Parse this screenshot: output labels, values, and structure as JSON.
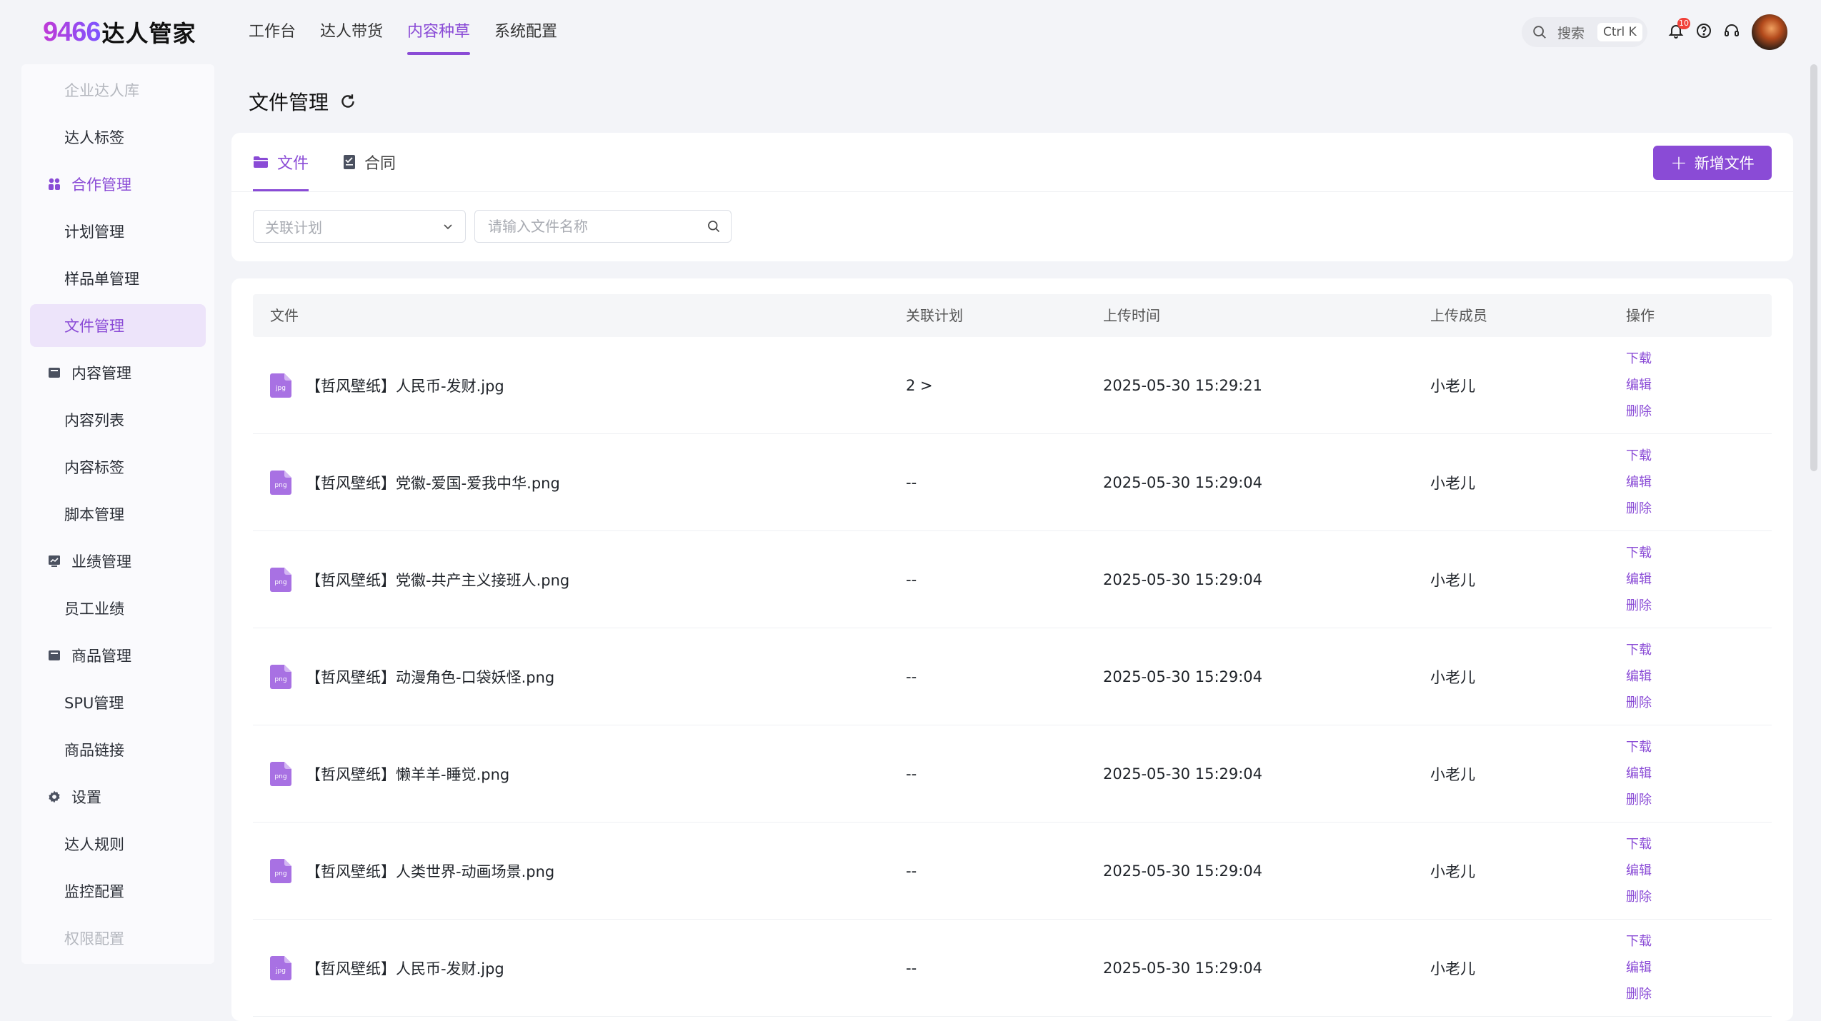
{
  "brand": {
    "number": "9466",
    "name": "达人管家"
  },
  "topnav": [
    {
      "label": "工作台",
      "active": false
    },
    {
      "label": "达人带货",
      "active": false
    },
    {
      "label": "内容种草",
      "active": true
    },
    {
      "label": "系统配置",
      "active": false
    }
  ],
  "search": {
    "label": "搜索",
    "shortcut": "Ctrl K"
  },
  "notifications": {
    "count": "10"
  },
  "sidebar": [
    {
      "label": "企业达人库",
      "kind": "sub",
      "state": "faded"
    },
    {
      "label": "达人标签",
      "kind": "sub"
    },
    {
      "label": "合作管理",
      "kind": "group",
      "icon": "users-icon",
      "state": "accent"
    },
    {
      "label": "计划管理",
      "kind": "sub"
    },
    {
      "label": "样品单管理",
      "kind": "sub"
    },
    {
      "label": "文件管理",
      "kind": "sub",
      "state": "active"
    },
    {
      "label": "内容管理",
      "kind": "group",
      "icon": "inbox-icon"
    },
    {
      "label": "内容列表",
      "kind": "sub"
    },
    {
      "label": "内容标签",
      "kind": "sub"
    },
    {
      "label": "脚本管理",
      "kind": "sub"
    },
    {
      "label": "业绩管理",
      "kind": "group",
      "icon": "chart-icon"
    },
    {
      "label": "员工业绩",
      "kind": "sub"
    },
    {
      "label": "商品管理",
      "kind": "group",
      "icon": "box-icon"
    },
    {
      "label": "SPU管理",
      "kind": "sub"
    },
    {
      "label": "商品链接",
      "kind": "sub"
    },
    {
      "label": "设置",
      "kind": "group",
      "icon": "gear-icon"
    },
    {
      "label": "达人规则",
      "kind": "sub"
    },
    {
      "label": "监控配置",
      "kind": "sub"
    },
    {
      "label": "权限配置",
      "kind": "sub",
      "state": "faded"
    }
  ],
  "page": {
    "title": "文件管理"
  },
  "tabs": [
    {
      "label": "文件",
      "active": true,
      "icon": "folder-icon"
    },
    {
      "label": "合同",
      "active": false,
      "icon": "contract-icon"
    }
  ],
  "add_button": "新增文件",
  "filters": {
    "plan_placeholder": "关联计划",
    "name_placeholder": "请输入文件名称"
  },
  "table": {
    "columns": [
      "文件",
      "关联计划",
      "上传时间",
      "上传成员",
      "操作"
    ],
    "actions": [
      "下载",
      "编辑",
      "删除"
    ],
    "rows": [
      {
        "type": "jpg",
        "name": "【哲风壁纸】人民币-发财.jpg",
        "plan": "2 >",
        "time": "2025-05-30 15:29:21",
        "member": "小老儿"
      },
      {
        "type": "png",
        "name": "【哲风壁纸】党徽-爱国-爱我中华.png",
        "plan": "--",
        "time": "2025-05-30 15:29:04",
        "member": "小老儿"
      },
      {
        "type": "png",
        "name": "【哲风壁纸】党徽-共产主义接班人.png",
        "plan": "--",
        "time": "2025-05-30 15:29:04",
        "member": "小老儿"
      },
      {
        "type": "png",
        "name": "【哲风壁纸】动漫角色-口袋妖怪.png",
        "plan": "--",
        "time": "2025-05-30 15:29:04",
        "member": "小老儿"
      },
      {
        "type": "png",
        "name": "【哲风壁纸】懒羊羊-睡觉.png",
        "plan": "--",
        "time": "2025-05-30 15:29:04",
        "member": "小老儿"
      },
      {
        "type": "png",
        "name": "【哲风壁纸】人类世界-动画场景.png",
        "plan": "--",
        "time": "2025-05-30 15:29:04",
        "member": "小老儿"
      },
      {
        "type": "jpg",
        "name": "【哲风壁纸】人民币-发财.jpg",
        "plan": "--",
        "time": "2025-05-30 15:29:04",
        "member": "小老儿"
      }
    ]
  },
  "colors": {
    "accent": "#8a4bd6",
    "accent_light": "#ede4fa",
    "badge": "#f0413a"
  }
}
